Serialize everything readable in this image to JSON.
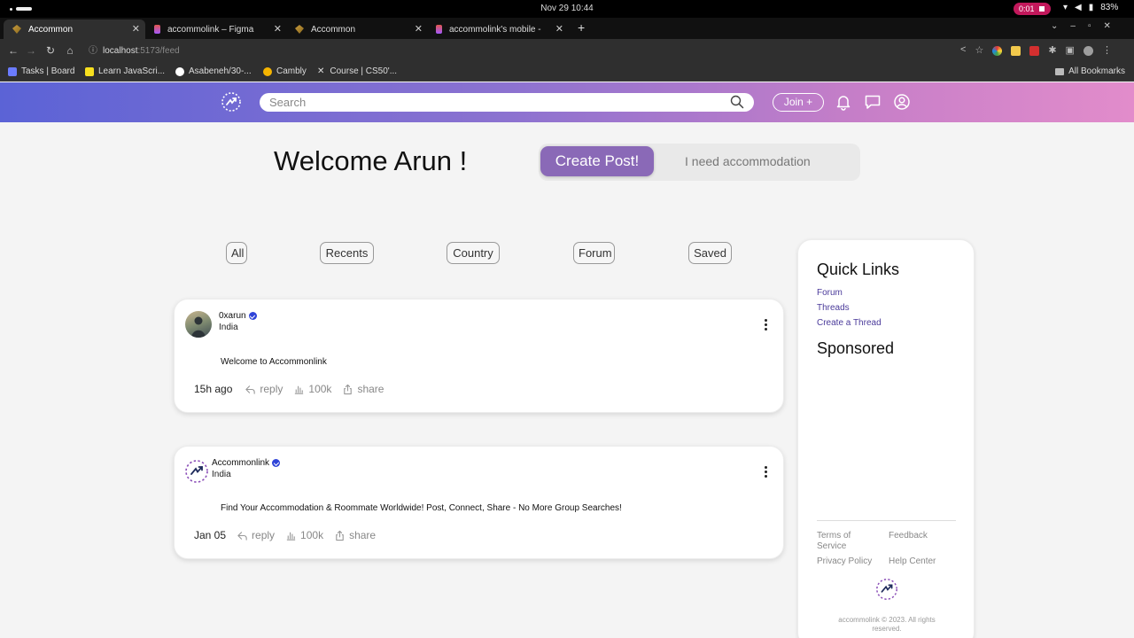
{
  "os": {
    "clock": "Nov 29  10:44",
    "recording": "0:01",
    "battery": "83%"
  },
  "browser": {
    "tabs": [
      {
        "label": "Accommon",
        "active": true
      },
      {
        "label": "accommolink – Figma",
        "active": false
      },
      {
        "label": "Accommon",
        "active": false
      },
      {
        "label": "accommolink's mobile -",
        "active": false
      }
    ],
    "url_host": "localhost",
    "url_path": ":5173/feed",
    "bookmarks": [
      "Tasks | Board",
      "Learn JavaScri...",
      "Asabeneh/30-...",
      "Cambly",
      "Course | CS50'..."
    ],
    "all_bookmarks": "All Bookmarks"
  },
  "header": {
    "search_placeholder": "Search",
    "join_label": "Join +"
  },
  "main": {
    "welcome": "Welcome Arun !",
    "create_post": "Create Post!",
    "need_accommodation": "I need accommodation",
    "filters": [
      "All",
      "Recents",
      "Country",
      "Forum",
      "Saved"
    ]
  },
  "posts": [
    {
      "username": "0xarun",
      "country": "India",
      "content": "Welcome to Accommonlink",
      "time": "15h ago",
      "reply": "reply",
      "views": "100k",
      "share": "share"
    },
    {
      "username": "Accommonlink",
      "country": "India",
      "content": "Find Your Accommodation & Roommate Worldwide! Post, Connect, Share - No More Group Searches!",
      "time": "Jan 05",
      "reply": "reply",
      "views": "100k",
      "share": "share"
    }
  ],
  "sidebar": {
    "quick_links_title": "Quick Links",
    "links": [
      "Forum",
      "Threads",
      "Create a Thread"
    ],
    "sponsored_title": "Sponsored",
    "footer": {
      "terms": "Terms of Service",
      "feedback": "Feedback",
      "privacy": "Privacy Policy",
      "help": "Help Center"
    },
    "copyright": "accommolink © 2023. All rights reserved."
  },
  "colors": {
    "accent": "#8a69b7",
    "header_start": "#5b63d6",
    "header_end": "#e28ccb",
    "link": "#4a3a9a",
    "verified": "#2f44d8"
  }
}
